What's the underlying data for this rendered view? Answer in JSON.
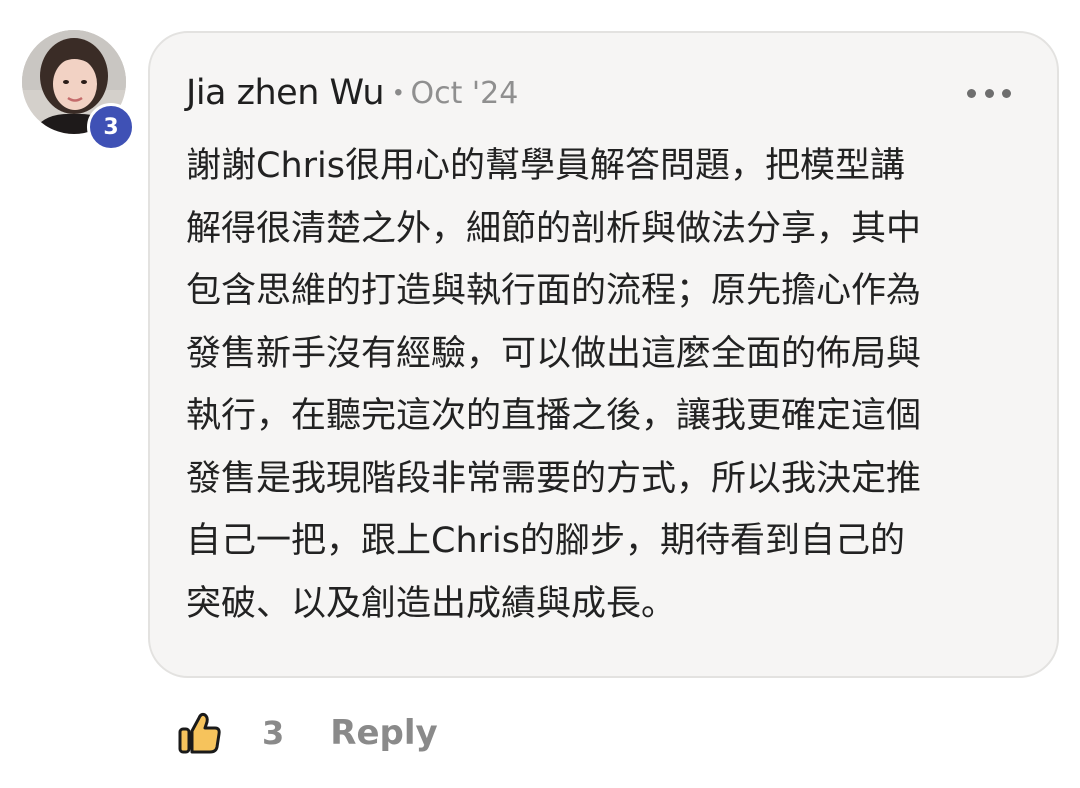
{
  "comment": {
    "author": "Jia zhen Wu",
    "separator": "•",
    "date": "Oct '24",
    "level_badge": "3",
    "more_icon": "more-horizontal-icon",
    "body_lines": [
      "謝謝Chris很用心的幫學員解答問題，把模型講",
      "解得很清楚之外，細節的剖析與做法分享，其中",
      "包含思維的打造與執行面的流程；原先擔心作為",
      "發售新手沒有經驗，可以做出這麼全面的佈局與",
      "執行，在聽完這次的直播之後，讓我更確定這個",
      "發售是我現階段非常需要的方式，所以我決定推",
      "自己一把，跟上Chris的腳步，期待看到自己的",
      "突破、以及創造出成績與成長。"
    ]
  },
  "actions": {
    "like_icon": "thumbs-up-icon",
    "like_count": "3",
    "reply_label": "Reply"
  },
  "colors": {
    "card_background": "#f6f5f4",
    "card_border": "#e3e2e0",
    "badge": "#3f51b5",
    "like_icon_fill": "#f6c35c",
    "muted_text": "#8a8a8a"
  }
}
